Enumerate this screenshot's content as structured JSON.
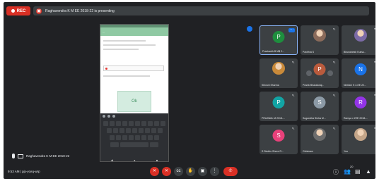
{
  "top_bar": {
    "rec_label": "REC",
    "presenting_text": "Raghavendra K M EE 2018-22 is presenting"
  },
  "phone": {
    "app_title": "...",
    "card_label": "Ok"
  },
  "participants": [
    {
      "name": "Prashanth B M$ 2...",
      "initial": "P",
      "color": "#1e8e3e",
      "kind": "avatar"
    },
    {
      "name": "Pavithra S",
      "kind": "photo",
      "color": "#8a6a5a"
    },
    {
      "name": "Bhuwanesh Kuma...",
      "kind": "photo",
      "color": "#7b6aa6"
    },
    {
      "name": "Shivani Sharma",
      "kind": "photo",
      "color": "#c98a3a"
    },
    {
      "name": "Pranik Bharadwaj...",
      "initial": "P",
      "color": "#ba5b3d",
      "kind": "avatar"
    },
    {
      "name": "Neelam S 2-EE 22...",
      "initial": "N",
      "color": "#1a73e8",
      "kind": "avatar"
    },
    {
      "name": "PRAJWAL M 2018-...",
      "initial": "P",
      "color": "#12a4a4",
      "kind": "avatar"
    },
    {
      "name": "Sugandha Sinha M...",
      "initial": "S",
      "color": "#8c9aa6",
      "kind": "avatar"
    },
    {
      "name": "Ramya v 2EE 2018-...",
      "initial": "R",
      "color": "#9334e6",
      "kind": "avatar"
    },
    {
      "name": "S Sindhu Shree R...",
      "initial": "S",
      "color": "#e8417a",
      "kind": "avatar"
    },
    {
      "name": "Girishram",
      "kind": "photo",
      "color": "#6d6d6d"
    },
    {
      "name": "You",
      "kind": "photo",
      "color": "#c4a588"
    }
  ],
  "presenter_label": "Raghavendra K M EE 2018-22",
  "meeting_info": "9:53 AM  |  pjx-yceq-wrp",
  "controls": {
    "mic": "✕",
    "cam": "✕",
    "captions": "cc",
    "raise_hand": "✋",
    "present": "▣",
    "more": "⋮",
    "end": "✆"
  },
  "right_icons": {
    "info": "ⓘ",
    "people": "👥",
    "people_count": "20",
    "chat": "▤",
    "activities": "▲"
  },
  "colors": {
    "background": "#202124",
    "tile": "#3c4043",
    "accent": "#1a73e8",
    "danger": "#d93025"
  }
}
